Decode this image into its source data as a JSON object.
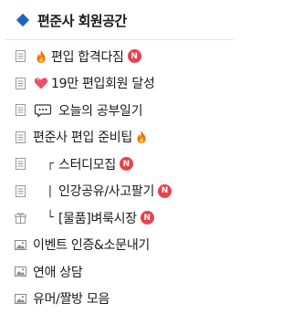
{
  "header": {
    "title": "편준사 회원공간"
  },
  "colors": {
    "accent": "#1d62c4",
    "badge": "#e8414a"
  },
  "menu": [
    {
      "icon": "board-icon",
      "emoji": "fire-icon",
      "label": "편입 합격다짐",
      "badge": "N"
    },
    {
      "icon": "board-icon",
      "emoji": "heart-icon",
      "label": "19만 편입회원 달성"
    },
    {
      "icon": "board-icon",
      "emoji": "speech-bubble-icon",
      "label": "오늘의 공부일기"
    },
    {
      "icon": "board-icon",
      "label": "편준사 편입 준비팁",
      "emoji_after": "fire-icon"
    },
    {
      "icon": "board-icon",
      "tree": "┌",
      "label": "스터디모집",
      "badge": "N"
    },
    {
      "icon": "board-icon",
      "tree": "|",
      "label": "인강공유/사고팔기",
      "badge": "N"
    },
    {
      "icon": "gift-icon",
      "tree": "└",
      "label": "[물품]벼룩시장",
      "badge": "N"
    },
    {
      "icon": "image-icon",
      "label": "이벤트 인증&소문내기"
    },
    {
      "icon": "image-icon",
      "label": "연애 상담"
    },
    {
      "icon": "image-icon",
      "label": "유머/짤방 모음"
    }
  ]
}
